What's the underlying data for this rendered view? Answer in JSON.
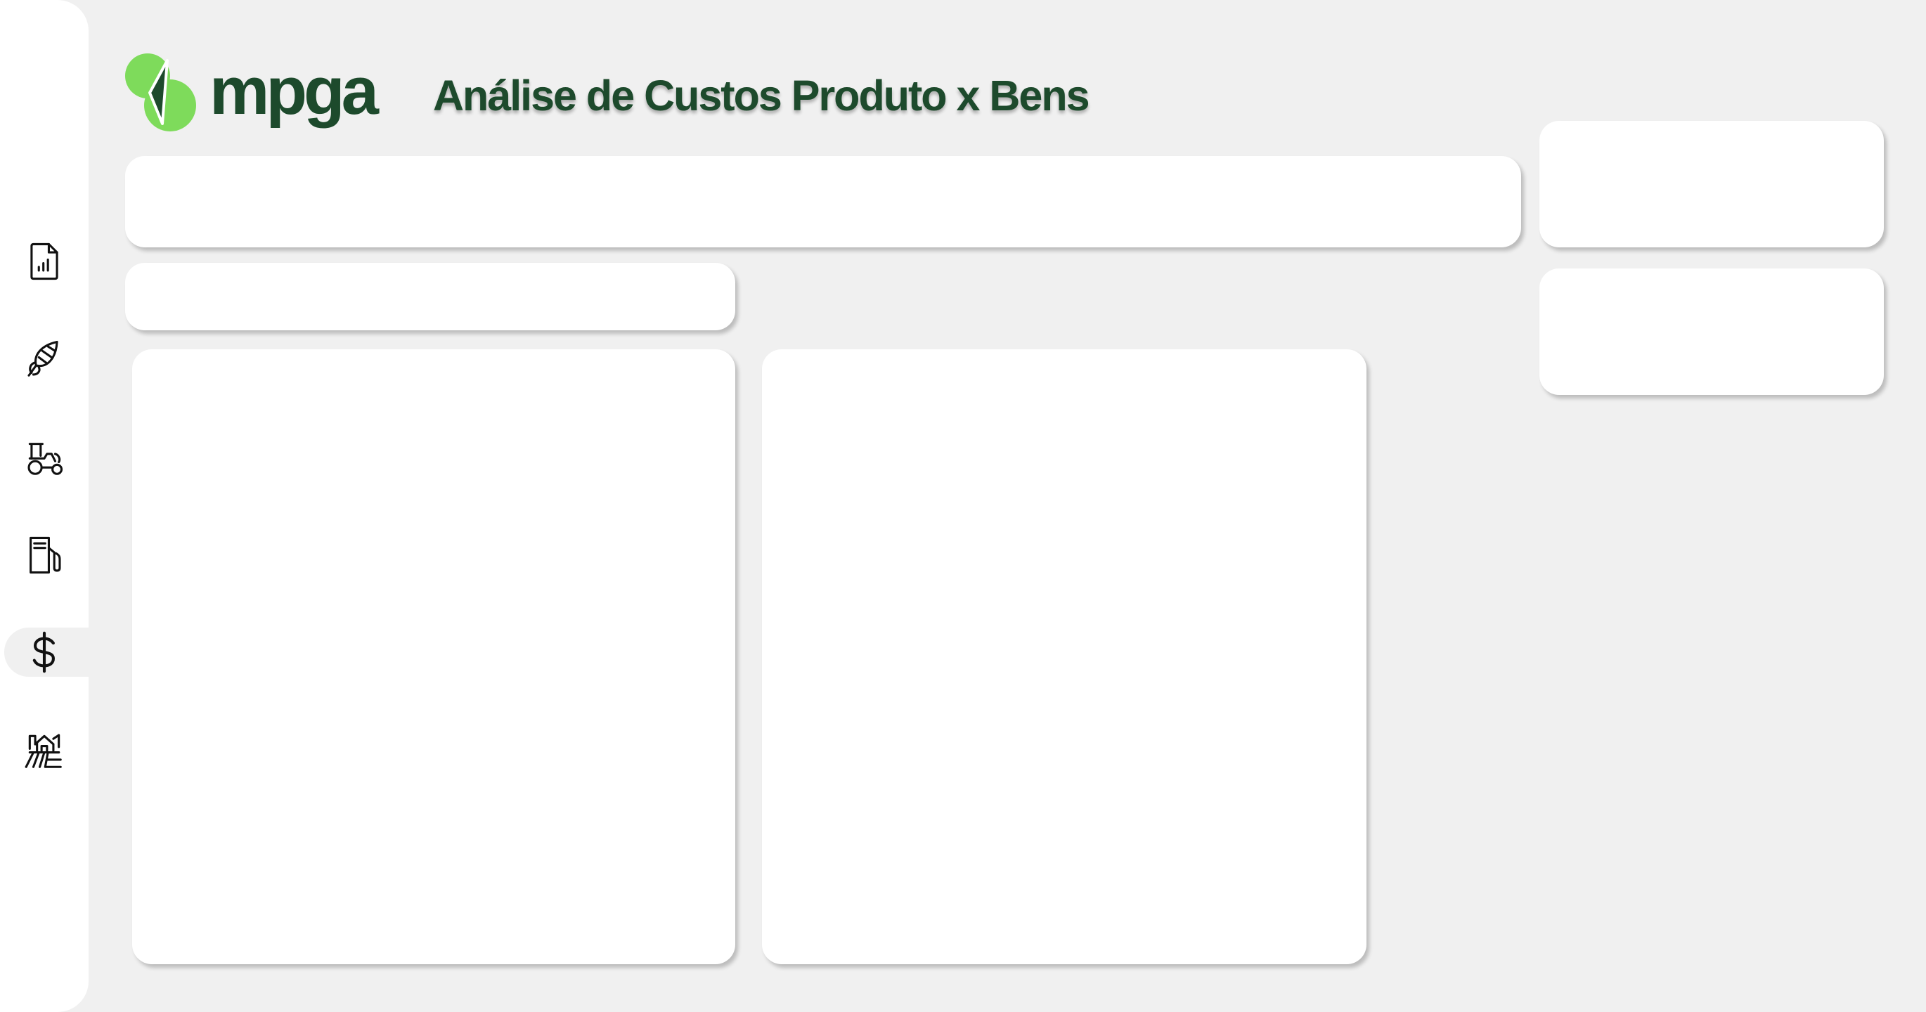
{
  "brand": {
    "name": "mpga",
    "logo_colors": [
      "#7edb5b",
      "#1d4a2c"
    ]
  },
  "header": {
    "title": "Análise de Custos Produto x Bens"
  },
  "sidebar": {
    "active_index": 4,
    "items": [
      {
        "icon": "report-icon"
      },
      {
        "icon": "corn-icon"
      },
      {
        "icon": "tractor-icon"
      },
      {
        "icon": "fuel-pump-icon"
      },
      {
        "icon": "dollar-icon"
      },
      {
        "icon": "farm-icon"
      }
    ]
  },
  "colors": {
    "background": "#f0f0f0",
    "card": "#ffffff",
    "brand_dark": "#1d4a2c",
    "brand_green": "#7edb5b"
  }
}
